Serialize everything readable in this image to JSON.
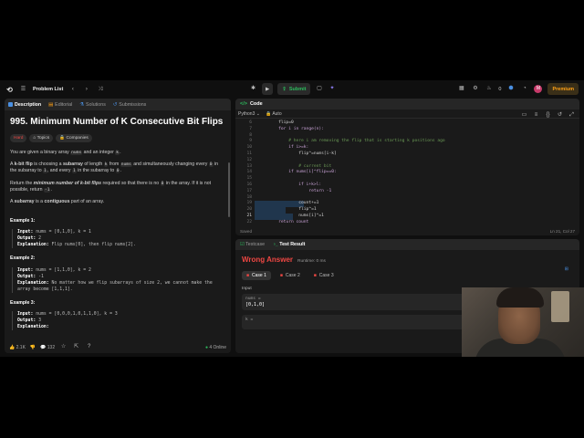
{
  "topbar": {
    "problem_list": "Problem List",
    "submit": "Submit",
    "notif_count": "0",
    "avatar": "M",
    "premium": "Premium"
  },
  "left_tabs": [
    "Description",
    "Editorial",
    "Solutions",
    "Submissions"
  ],
  "problem": {
    "title": "995. Minimum Number of K Consecutive Bit Flips",
    "difficulty": "Hard",
    "topics": "Topics",
    "companies": "Companies",
    "p1_a": "You are given a binary array ",
    "p1_code1": "nums",
    "p1_b": " and an integer ",
    "p1_code2": "k",
    "p1_c": ".",
    "p2_a": "A ",
    "p2_b": "k-bit flip",
    "p2_c": " is choosing a ",
    "p2_d": "subarray",
    "p2_e": " of length ",
    "p2_code1": "k",
    "p2_f": " from ",
    "p2_code2": "nums",
    "p2_g": " and simultaneously changing every ",
    "p2_code3": "0",
    "p2_h": " in the subarray to ",
    "p2_code4": "1",
    "p2_i": ", and every ",
    "p2_code5": "1",
    "p2_j": " in the subarray to ",
    "p2_code6": "0",
    "p2_k": ".",
    "p3_a": "Return the ",
    "p3_b": "minimum number of k-bit flips",
    "p3_c": " required so that there is no ",
    "p3_code1": "0",
    "p3_d": " in the array. If it is not possible, return ",
    "p3_code2": "-1",
    "p3_e": ".",
    "p4_a": "A ",
    "p4_b": "subarray",
    "p4_c": " is a ",
    "p4_d": "contiguous",
    "p4_e": " part of an array.",
    "examples": [
      {
        "h": "Example 1:",
        "input": "nums = [0,1,0], k = 1",
        "output": "2",
        "explanation": "Flip nums[0], then flip nums[2]."
      },
      {
        "h": "Example 2:",
        "input": "nums = [1,1,0], k = 2",
        "output": "-1",
        "explanation": "No matter how we flip subarrays of size 2, we cannot make the array become [1,1,1]."
      },
      {
        "h": "Example 3:",
        "input": "nums = [0,0,0,1,0,1,1,0], k = 3",
        "output": "3",
        "explanation": ""
      }
    ],
    "labels": {
      "input": "Input:",
      "output": "Output:",
      "explanation": "Explanation:"
    }
  },
  "left_footer": {
    "likes": "2.1K",
    "comments": "132",
    "online": "4 Online"
  },
  "code_panel": {
    "title": "Code",
    "language": "Python3",
    "auto": "Auto",
    "status": "Saved",
    "cursor": "Ln 21, Col 27",
    "lines": [
      {
        "n": "6",
        "t": "        flip=0"
      },
      {
        "n": "7",
        "t": "        for i in range(n):"
      },
      {
        "n": "8",
        "t": ""
      },
      {
        "n": "9",
        "t": "            # here i am removing the flip that is starting k positions ago"
      },
      {
        "n": "10",
        "t": "            if i>=k:"
      },
      {
        "n": "11",
        "t": "                flip^=nums[i-k]"
      },
      {
        "n": "12",
        "t": ""
      },
      {
        "n": "13",
        "t": "                # current bit"
      },
      {
        "n": "14",
        "t": "            if nums[i]^flip==0:"
      },
      {
        "n": "15",
        "t": ""
      },
      {
        "n": "16",
        "t": "                if i+k>l:"
      },
      {
        "n": "17",
        "t": "                    return -1"
      },
      {
        "n": "18",
        "t": ""
      },
      {
        "n": "19",
        "t": "                count+=1"
      },
      {
        "n": "20",
        "t": "                flip^=1"
      },
      {
        "n": "21",
        "t": "                nums[i]^=1"
      },
      {
        "n": "22",
        "t": "        return count"
      }
    ]
  },
  "result_panel": {
    "tabs": [
      "Testcase",
      "Test Result"
    ],
    "verdict": "Wrong Answer",
    "runtime": "Runtime: 0 ms",
    "cases": [
      "Case 1",
      "Case 2",
      "Case 3"
    ],
    "input_label": "Input",
    "var1": "nums =",
    "val1": "[0,1,0]",
    "var2": "k ="
  },
  "colors": {
    "accent": "#ffa116",
    "hard": "#ef4743",
    "success": "#2cbb5d",
    "selection": "#264f78"
  }
}
